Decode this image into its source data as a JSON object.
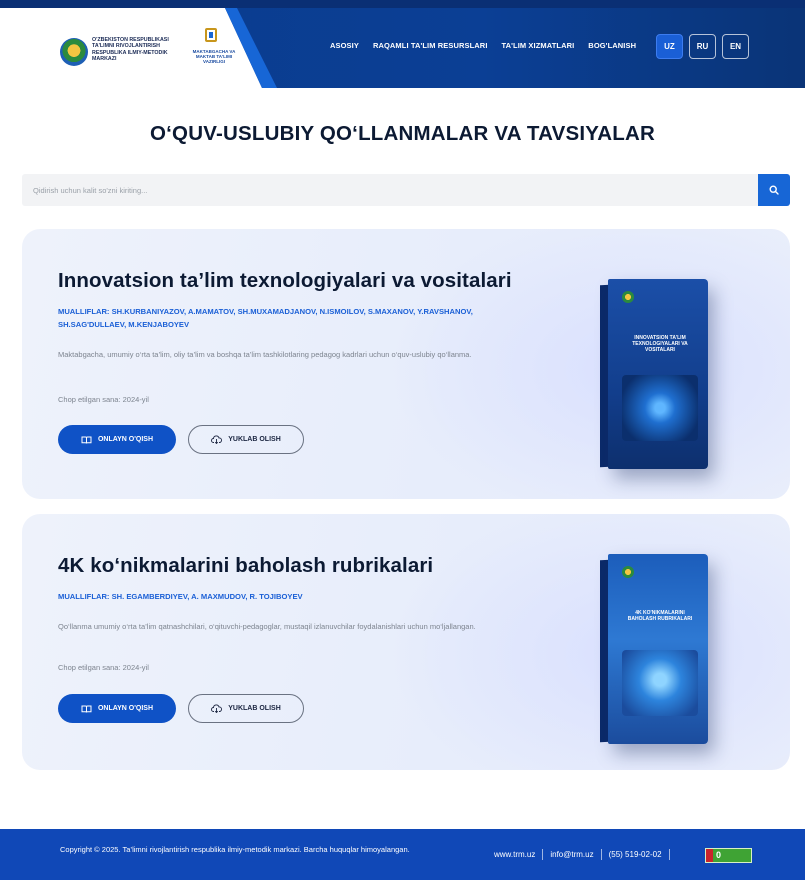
{
  "header": {
    "org_name": "O'ZBEKISTON RESPUBLIKASI TA'LIMNI RIVOJLANTIRISH RESPUBLIKA ILMIY-METODIK MARKAZI",
    "ministry_name": "MAKTABGACHA VA MAKTAB TA'LIMI VAZIRLIGI",
    "nav": [
      "ASOSIY",
      "RAQAMLI TA'LIM RESURSLARI",
      "TA'LIM XIZMATLARI",
      "BOG'LANISH"
    ],
    "languages": [
      "UZ",
      "RU",
      "EN"
    ],
    "active_language": "UZ"
  },
  "page": {
    "title": "O‘QUV-USLUBIY QO‘LLANMALAR VA TAVSIYALAR"
  },
  "search": {
    "placeholder": "Qidirish uchun kalit so'zni kiriting...",
    "value": "",
    "icon": "search-icon"
  },
  "books": [
    {
      "title": "Innovatsion ta’lim texnologiyalari va vositalari",
      "authors": "MUALLIFLAR: SH.KURBANIYAZOV, A.MAMATOV, SH.MUXAMADJANOV, N.ISMOILOV, S.MAXANOV, Y.RAVSHANOV, SH.SAG'DULLAEV, M.KENJABOYEV",
      "description": "Maktabgacha, umumiy o‘rta ta’lim, oliy ta’lim va boshqa ta’lim tashkilotlaring pedagog kadrlari uchun o‘quv-uslubiy qo‘llanma.",
      "date": "Chop etilgan sana: 2024-yil",
      "read_label": "ONLAYN O'QISH",
      "download_label": "YUKLAB OLISH",
      "cover_title": "INNOVATSION TA'LIM TEXNOLOGIYALARI VA VOSITALARI"
    },
    {
      "title": "4K ko‘nikmalarini baholash rubrikalari",
      "authors": "MUALLIFLAR: SH. EGAMBERDIYEV, A. MAXMUDOV, R. TOJIBOYEV",
      "description": "Qo‘llanma umumiy o‘rta ta’lim qatnashchilari, o‘qituvchi-pedagoglar, mustaqil izlanuvchilar foydalanishlari uchun mo‘ljallangan.",
      "date": "Chop etilgan sana: 2024-yil",
      "read_label": "ONLAYN O'QISH",
      "download_label": "YUKLAB OLISH",
      "cover_title": "4K KO'NIKMALARINI BAHOLASH RUBRIKALARI"
    }
  ],
  "footer": {
    "copyright": "Copyright © 2025. Ta’limni rivojlantirish respublika ilmiy-metodik markazi. Barcha huquqlar himoyalangan.",
    "website": "www.trm.uz",
    "email": "info@trm.uz",
    "phone": "(55) 519-02-02",
    "counter_value": "0"
  },
  "colors": {
    "primary": "#0f52c6",
    "header_bg": "#0b3f95",
    "footer_bg": "#1048b7",
    "card_bg": "#e9eefb",
    "title": "#0c1a33",
    "author_blue": "#1a5fd6"
  }
}
